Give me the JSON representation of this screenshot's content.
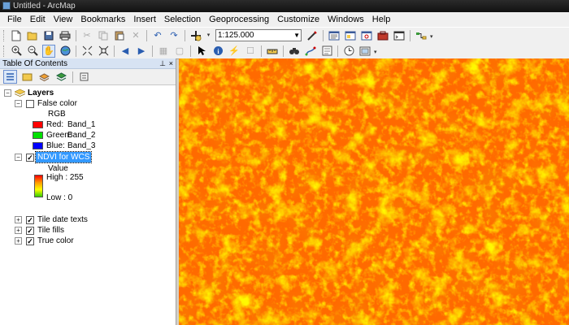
{
  "window": {
    "title": "Untitled - ArcMap"
  },
  "menu": [
    "File",
    "Edit",
    "View",
    "Bookmarks",
    "Insert",
    "Selection",
    "Geoprocessing",
    "Customize",
    "Windows",
    "Help"
  ],
  "toolbar1": {
    "scale_value": "1:125.000",
    "icons": [
      "new-document-icon",
      "open-folder-icon",
      "save-icon",
      "print-icon",
      "cut-icon",
      "copy-icon",
      "paste-icon",
      "delete-icon",
      "undo-icon",
      "redo-icon",
      "add-data-icon",
      "editor-toolbar-icon",
      "table-of-contents-icon",
      "catalog-icon",
      "search-window-icon",
      "arctoolbox-icon",
      "python-window-icon",
      "model-builder-icon"
    ]
  },
  "toolbar2": {
    "icons": [
      "zoom-in-icon",
      "zoom-out-icon",
      "pan-icon",
      "full-extent-icon",
      "fixed-zoom-in-icon",
      "fixed-zoom-out-icon",
      "back-extent-icon",
      "forward-extent-icon",
      "select-features-icon",
      "clear-selection-icon",
      "select-elements-icon",
      "identify-icon",
      "hyperlink-icon",
      "html-popup-icon",
      "measure-icon",
      "find-icon",
      "find-route-icon",
      "go-to-xy-icon",
      "time-slider-icon",
      "create-viewer-window-icon"
    ]
  },
  "toc": {
    "title": "Table Of Contents",
    "pin_glyph": "⊥",
    "close_glyph": "×",
    "tools": [
      "list-by-drawing-order-icon",
      "list-by-source-icon",
      "list-by-visibility-icon",
      "list-by-selection-icon",
      "options-icon"
    ],
    "root_label": "Layers",
    "false_color": {
      "label": "False color",
      "checked": false,
      "rgb_label": "RGB",
      "bands": [
        {
          "channel": "Red:",
          "band": "Band_1",
          "color": "#ff0000"
        },
        {
          "channel": "Green:",
          "band": "Band_2",
          "color": "#00e000"
        },
        {
          "channel": "Blue:",
          "band": "Band_3",
          "color": "#0000ff"
        }
      ]
    },
    "ndvi": {
      "label": "NDVI for WCS",
      "checked": true,
      "value_label": "Value",
      "high_label": "High : 255",
      "low_label": "Low : 0",
      "ramp_colors": [
        "#ff0000",
        "#ff9900",
        "#ffff00",
        "#33cc00"
      ]
    },
    "other_layers": [
      {
        "label": "Tile date texts",
        "checked": true
      },
      {
        "label": "Tile fills",
        "checked": true
      },
      {
        "label": "True color",
        "checked": true
      }
    ]
  },
  "map": {
    "base_color": "#ff6a00",
    "highlight_colors": [
      "#ff9a00",
      "#ffc400",
      "#ffe600",
      "#ff3800"
    ]
  }
}
